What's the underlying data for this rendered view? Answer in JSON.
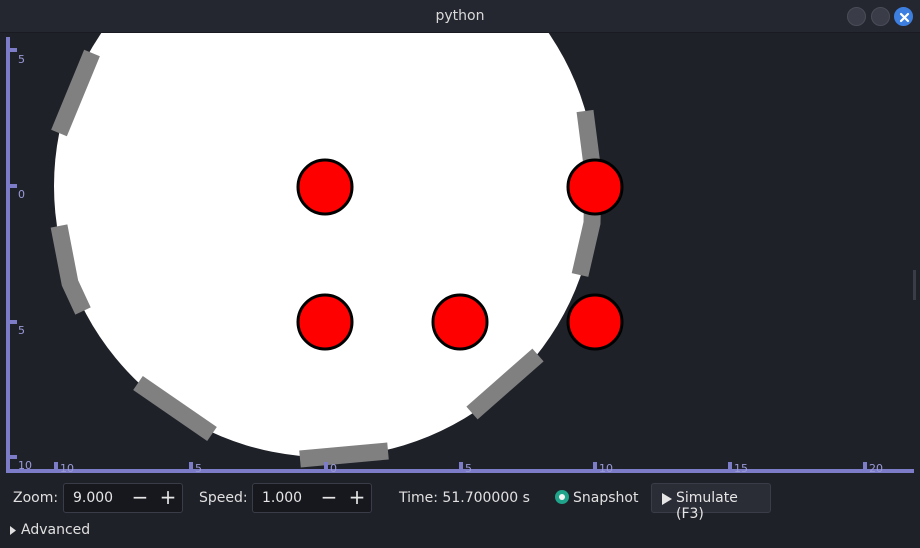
{
  "window": {
    "title": "python"
  },
  "axes": {
    "y_ticks": [
      "5",
      "0",
      "5",
      "10"
    ],
    "x_ticks": [
      "10",
      "5",
      "0",
      "5",
      "10",
      "15",
      "20"
    ]
  },
  "controls": {
    "zoom_label": "Zoom:",
    "zoom_value": "9.000",
    "speed_label": "Speed:",
    "speed_value": "1.000",
    "time_text": "Time: 51.700000 s",
    "snapshot_label": "Snapshot",
    "simulate_label": "Simulate (F3)",
    "advanced_label": "Advanced",
    "minus_glyph": "−",
    "plus_glyph": "+"
  },
  "colors": {
    "ball": "#ff0000",
    "arena": "#ffffff",
    "wall": "#808080",
    "axis": "#7c7cc8"
  }
}
